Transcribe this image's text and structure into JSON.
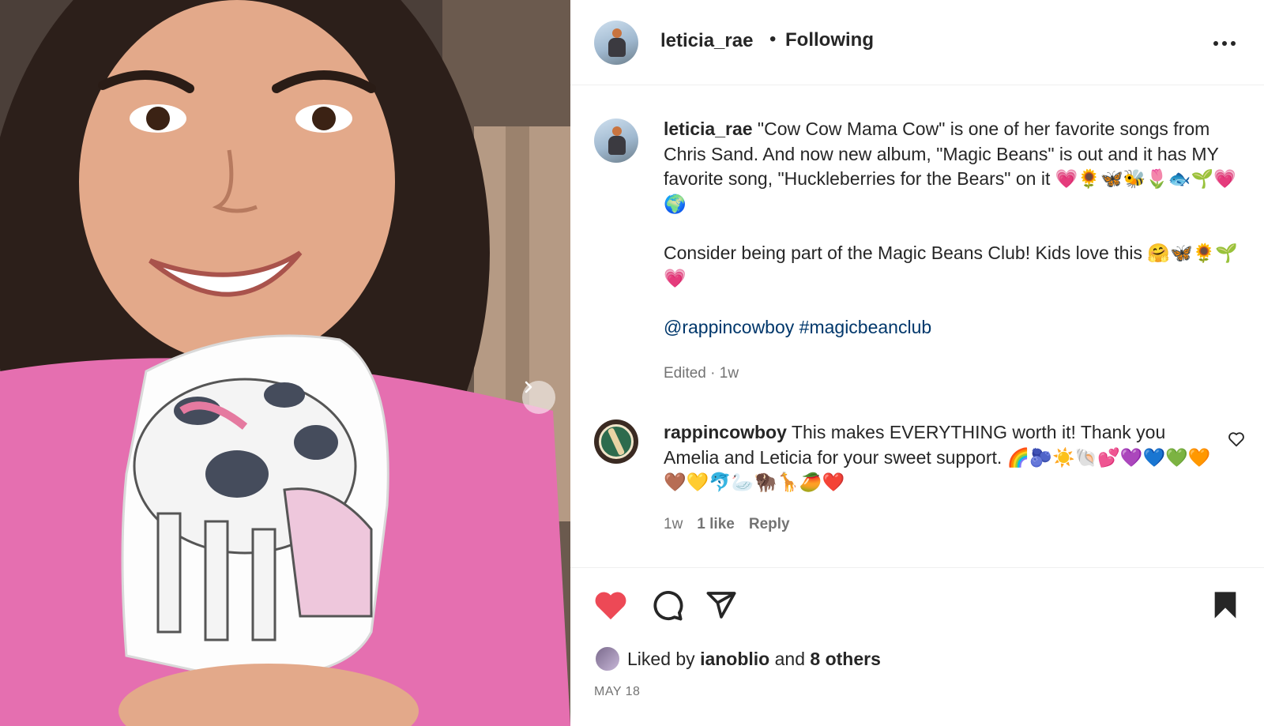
{
  "post": {
    "username": "leticia_rae",
    "dot": "•",
    "follow_status": "Following",
    "more_label": "•••"
  },
  "caption": {
    "username": "leticia_rae",
    "paragraph1": "\"Cow Cow Mama Cow\" is one of her favorite songs from Chris Sand. And now new album, \"Magic Beans\" is out and it has MY favorite song, \"Huckleberries for the Bears\" on it 💗🌻🦋🐝🌷🐟🌱💗🌍",
    "paragraph2": "Consider being part of the Magic Beans Club! Kids love this 🤗🦋🌻🌱💗",
    "tags": "@rappincowboy #magicbeanclub",
    "edited": "Edited · 1w"
  },
  "comment": {
    "username": "rappincowboy",
    "text": "This makes EVERYTHING worth it! Thank you Amelia and Leticia for your sweet support. 🌈🫐☀️🐚💕💜💙💚🧡🤎💛🐬🦢🦬🦒🥭❤️",
    "time": "1w",
    "likes": "1 like",
    "reply": "Reply"
  },
  "likes": {
    "prefix": "Liked by",
    "user": "ianoblio",
    "mid": "and",
    "others": "8 others"
  },
  "date": "MAY 18",
  "colors": {
    "like_red": "#ed4956",
    "link_blue": "#00376b",
    "muted": "#737373",
    "text": "#262626"
  },
  "icons": [
    "more-icon",
    "heart-outline-icon",
    "heart-filled-icon",
    "comment-icon",
    "share-icon",
    "bookmark-icon",
    "chevron-right-icon"
  ]
}
